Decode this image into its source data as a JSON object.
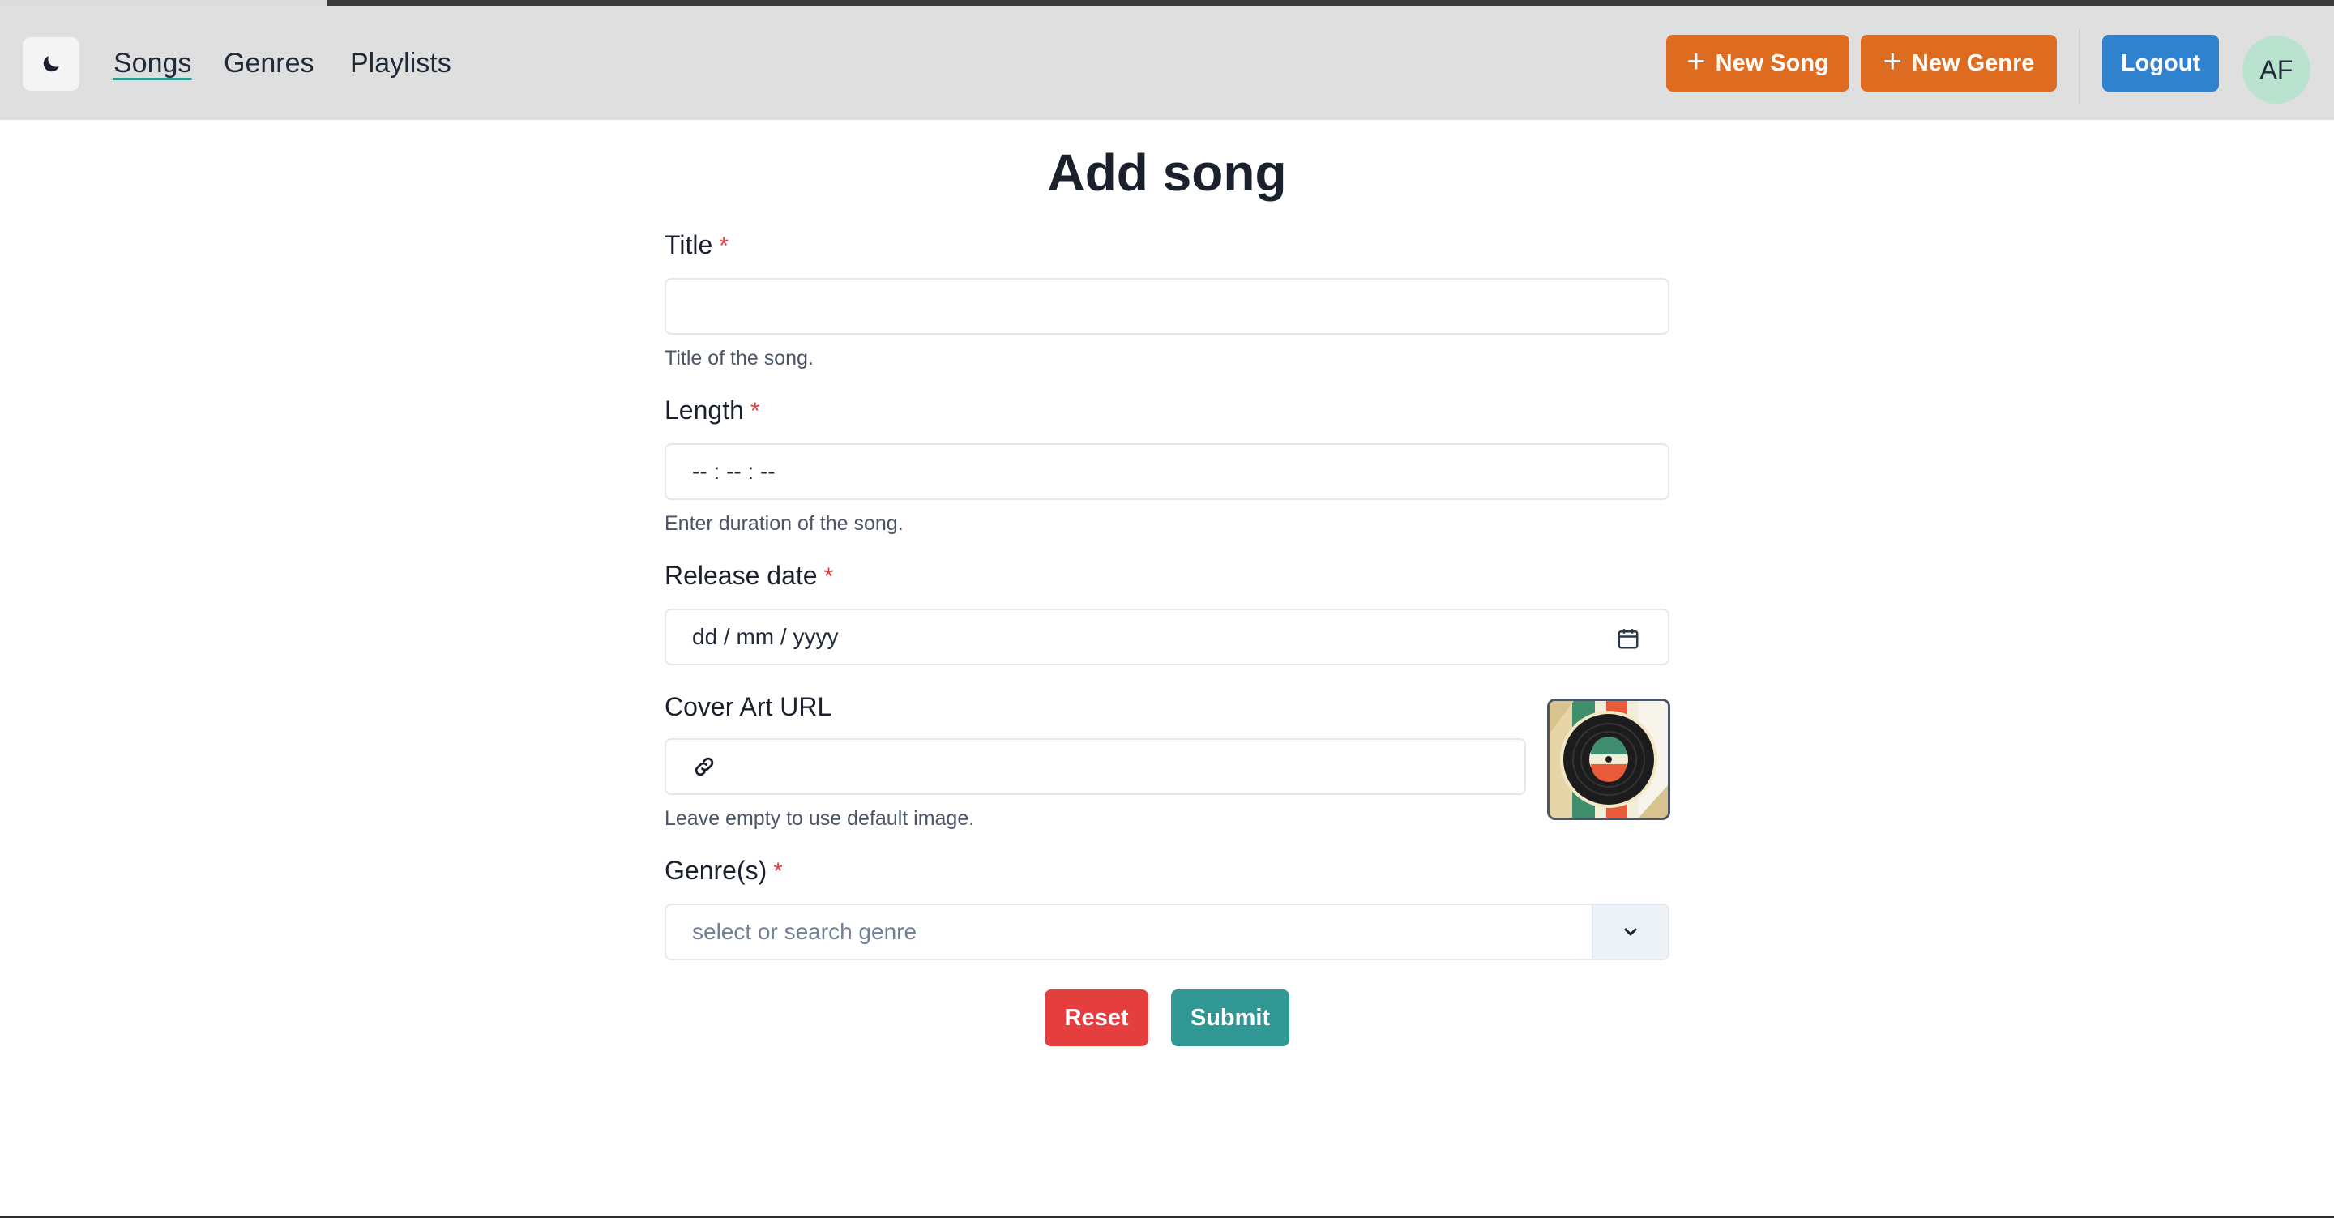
{
  "nav": {
    "theme_icon": "moon-icon",
    "links": [
      {
        "label": "Songs",
        "active": true
      },
      {
        "label": "Genres",
        "active": false
      },
      {
        "label": "Playlists",
        "active": false
      }
    ],
    "new_song": "New Song",
    "new_genre": "New Genre",
    "logout": "Logout",
    "avatar_initials": "AF"
  },
  "page": {
    "title": "Add song"
  },
  "form": {
    "title": {
      "label": "Title",
      "required_mark": "*",
      "value": "",
      "help": "Title of the song."
    },
    "length": {
      "label": "Length",
      "required_mark": "*",
      "placeholder": "-- : -- : --",
      "help": "Enter duration of the song."
    },
    "release_date": {
      "label": "Release date",
      "required_mark": "*",
      "placeholder": "dd / mm / yyyy",
      "icon": "calendar-icon"
    },
    "cover_art": {
      "label": "Cover Art URL",
      "icon": "link-icon",
      "value": "",
      "help": "Leave empty to use default image.",
      "preview": "vinyl-record-cover"
    },
    "genres": {
      "label": "Genre(s)",
      "required_mark": "*",
      "placeholder": "select or search genre",
      "icon": "chevron-down-icon"
    },
    "reset": "Reset",
    "submit": "Submit"
  },
  "colors": {
    "orange": "#dd6b20",
    "blue": "#3182ce",
    "red": "#e53e3e",
    "teal": "#319795",
    "navbar": "#dfdfdf"
  }
}
